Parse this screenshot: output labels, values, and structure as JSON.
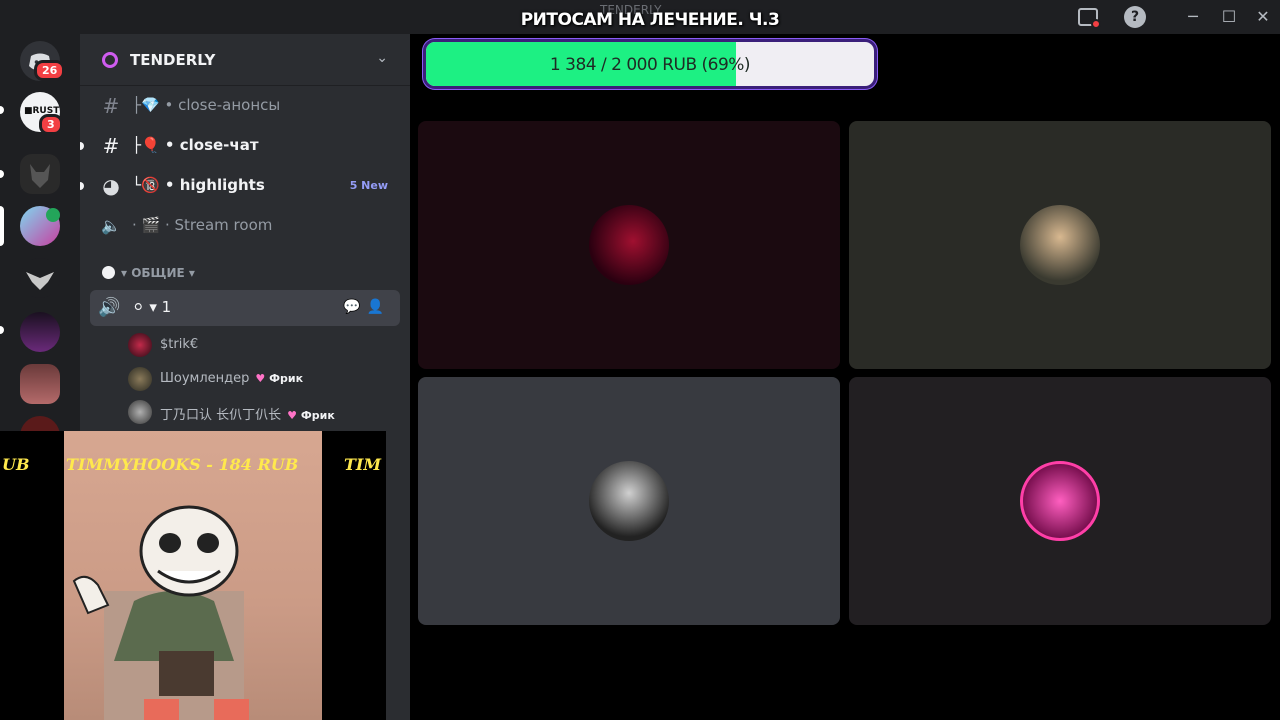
{
  "window": {
    "ghost_title": "TENDERLY",
    "stream_title": "РИТОСАМ НА ЛЕЧЕНИЕ. Ч.3",
    "help_label": "?",
    "minimize": "─",
    "maximize": "☐",
    "close": "✕"
  },
  "servers": {
    "dm_badge": "26",
    "rust_badge": "3"
  },
  "sidebar": {
    "server_name": "TENDERLY",
    "channels": [
      {
        "icon": "#",
        "label": "├💎 • close-анонсы"
      },
      {
        "icon": "#",
        "label": "├🎈 • close-чат"
      },
      {
        "icon": "◕",
        "label": "└🔞 • highlights",
        "badge": "5 New"
      },
      {
        "icon": "🔈",
        "label": "· 🎬 · Stream room"
      }
    ],
    "category": "▾ ОБЩИЕ ▾",
    "voice_channel": "⚪ ▾ 1",
    "members": [
      {
        "name": "$trik€",
        "tag": ""
      },
      {
        "name": "Шоумлендер",
        "tag": "Фрик"
      },
      {
        "name": "丁乃口认 长仈丁仈长",
        "tag": "Фрик"
      }
    ]
  },
  "overlay": {
    "ticker_left": "UB",
    "ticker_main": "TIMMYHOOKS - 184 RUB",
    "ticker_right": "TIM"
  },
  "goal": {
    "text": "1 384 / 2 000 RUB (69%)",
    "current": 1384,
    "target": 2000,
    "percent": 69,
    "fill_color": "#1df083"
  },
  "colors": {
    "tile1": "#1b0a10",
    "tile2": "#2a2b26",
    "tile3": "#383a40",
    "tile4": "#221f22"
  }
}
